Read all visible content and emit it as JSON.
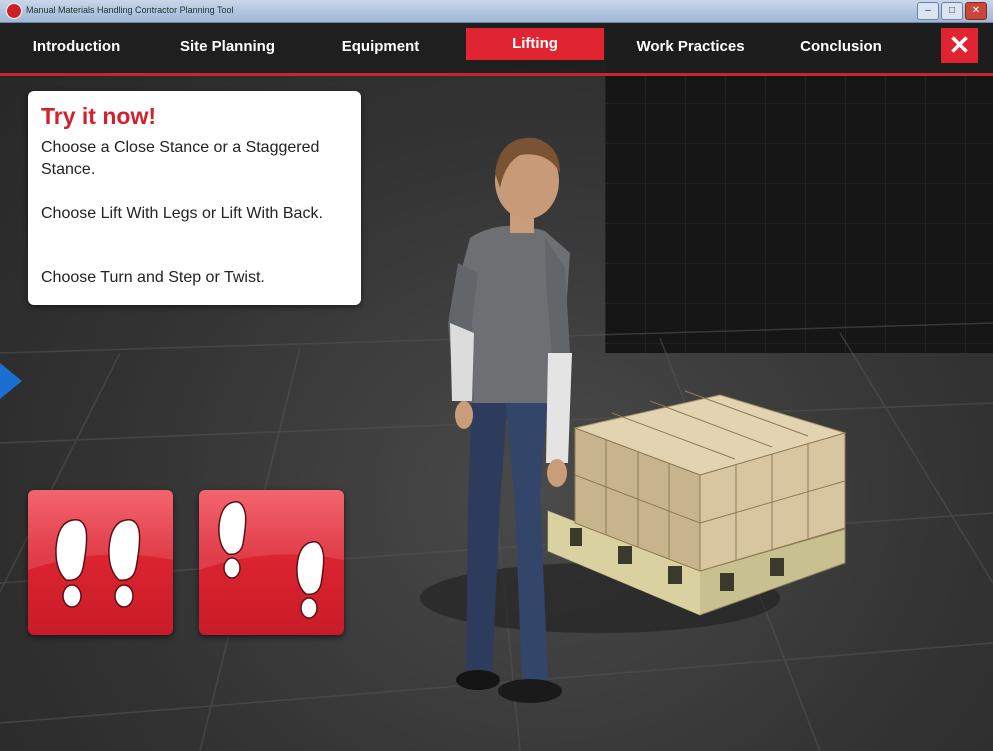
{
  "window": {
    "title": "Manual Materials Handling Contractor Planning Tool",
    "buttons": [
      "–",
      "□",
      "✕"
    ]
  },
  "nav": {
    "tabs": [
      {
        "label": "Introduction"
      },
      {
        "label": "Site Planning"
      },
      {
        "label": "Equipment"
      },
      {
        "label": "Lifting"
      },
      {
        "label": "Work Practices"
      },
      {
        "label": "Conclusion"
      }
    ],
    "active": "Lifting",
    "close_label": "✕"
  },
  "panel": {
    "heading": "Try it now!",
    "lines": [
      "Choose a Close Stance or a Staggered Stance.",
      "Choose Lift With Legs or Lift With Back.",
      "Choose Turn and Step or Twist."
    ]
  },
  "choices": [
    {
      "icon": "close-stance-feet-icon"
    },
    {
      "icon": "staggered-stance-feet-icon"
    }
  ],
  "colors": {
    "accent": "#e02431",
    "navbar": "#1e1e1e",
    "wall": "#161616"
  }
}
